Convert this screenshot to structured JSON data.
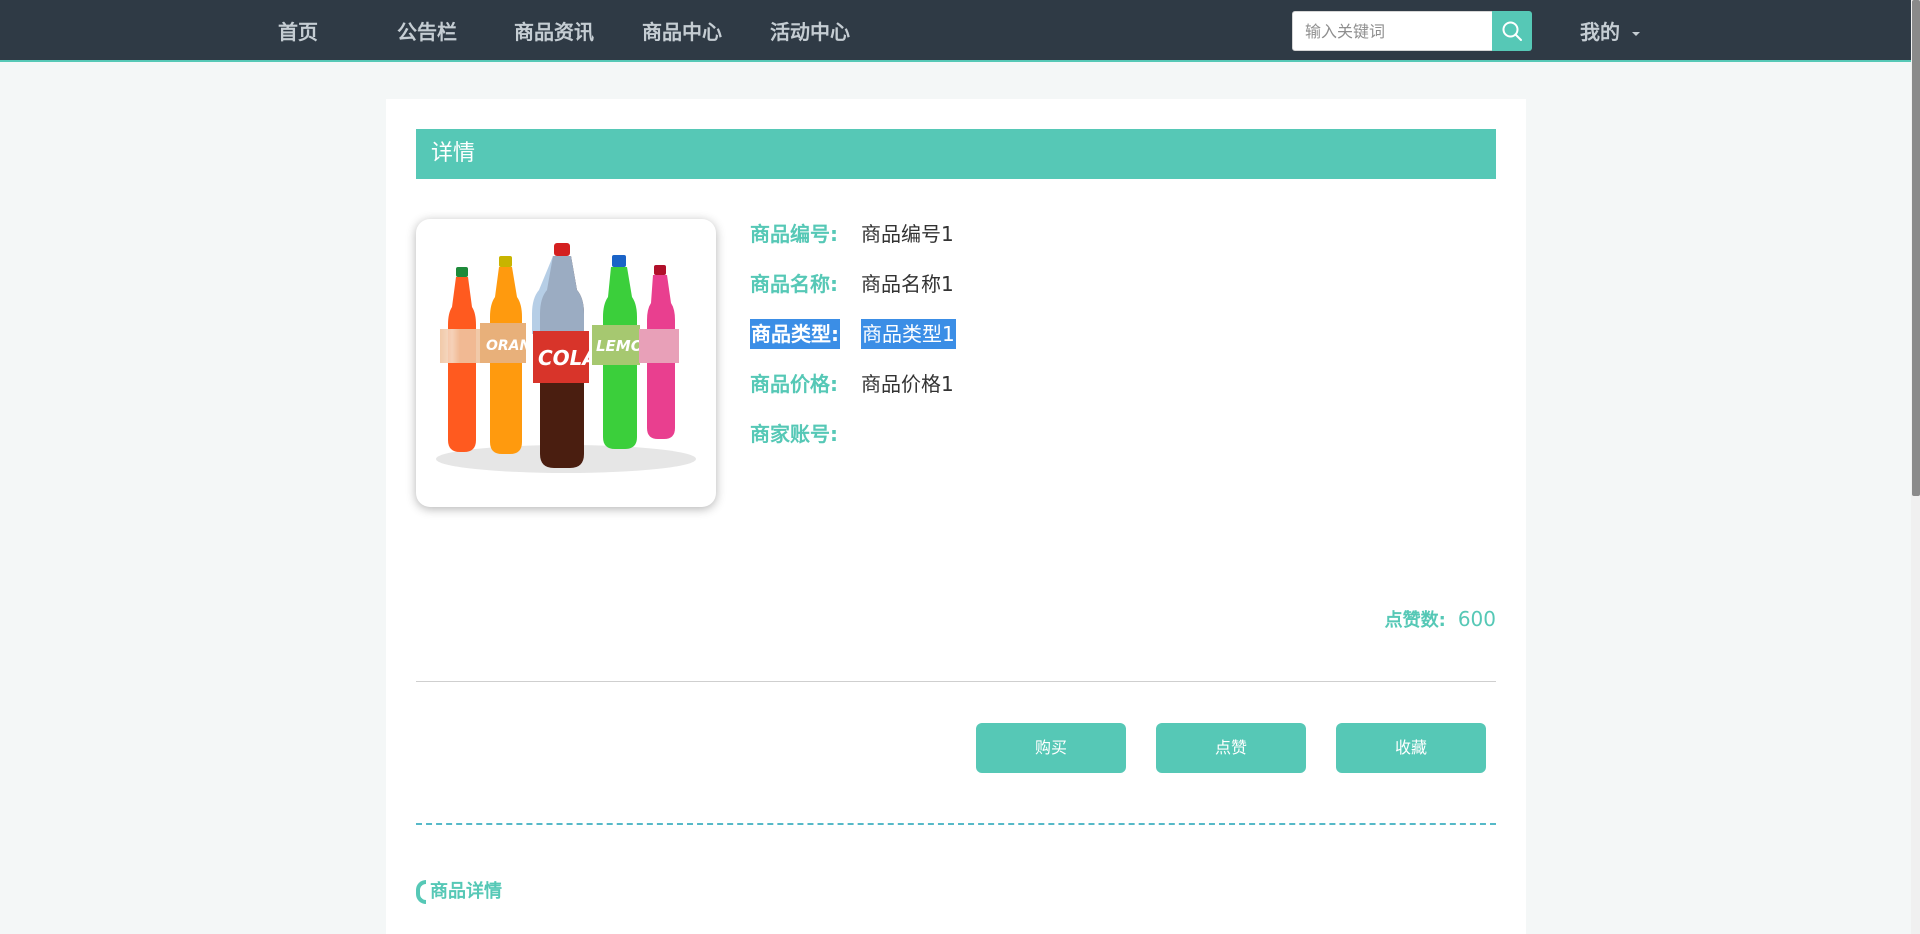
{
  "nav": {
    "items": [
      {
        "label": "首页"
      },
      {
        "label": "公告栏"
      },
      {
        "label": "商品资讯"
      },
      {
        "label": "商品中心"
      },
      {
        "label": "活动中心"
      }
    ],
    "search_placeholder": "输入关键词",
    "user_label": "我的"
  },
  "detail": {
    "header": "详情",
    "fields": [
      {
        "label": "商品编号:",
        "value": "商品编号1"
      },
      {
        "label": "商品名称:",
        "value": "商品名称1"
      },
      {
        "label": "商品类型:",
        "value": "商品类型1",
        "selected": true
      },
      {
        "label": "商品价格:",
        "value": "商品价格1"
      },
      {
        "label": "商家账号:",
        "value": ""
      }
    ],
    "likes_label": "点赞数:",
    "likes_count": "600",
    "image_subject": "soda bottles",
    "bottle_labels": [
      "ORAN",
      "COLA",
      "LEMO"
    ]
  },
  "actions": {
    "buy": "购买",
    "like": "点赞",
    "favorite": "收藏"
  },
  "section": {
    "title": "商品详情"
  },
  "colors": {
    "accent": "#56c8b6",
    "nav_bg": "#2f3a45",
    "selection": "#3b8ee6"
  }
}
